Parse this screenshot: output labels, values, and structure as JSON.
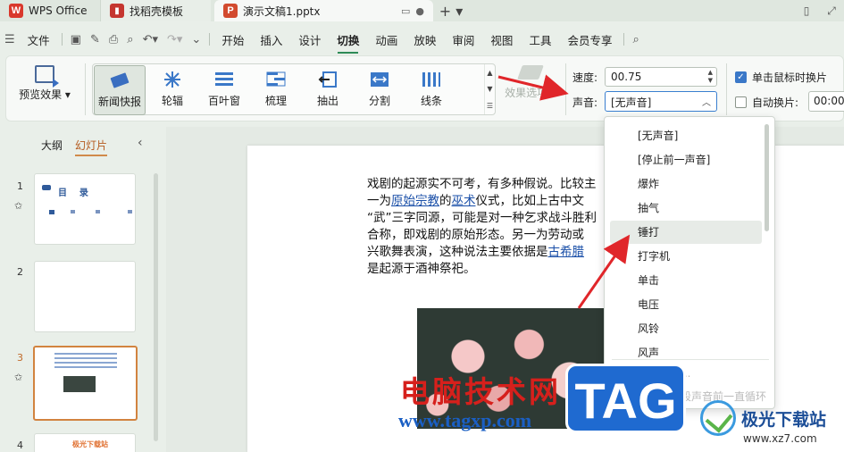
{
  "titlebar": {
    "app_tab": "WPS Office",
    "template_tab": "找稻壳模板",
    "doc_tab": "演示文稿1.pptx"
  },
  "menu": {
    "file": "文件",
    "items": [
      "开始",
      "插入",
      "设计",
      "切换",
      "动画",
      "放映",
      "审阅",
      "视图",
      "工具",
      "会员专享"
    ],
    "active": "切换"
  },
  "ribbon": {
    "preview_label": "预览效果",
    "transitions": [
      "新闻快报",
      "轮辐",
      "百叶窗",
      "梳理",
      "抽出",
      "分割",
      "线条"
    ],
    "selected_transition": "新闻快报",
    "effect_options": "效果选项",
    "speed_label": "速度:",
    "speed_value": "00.75",
    "sound_label": "声音:",
    "sound_value": "[无声音]",
    "click_advance_label": "单击鼠标时换片",
    "auto_advance_label": "自动换片:",
    "auto_time": "00:00"
  },
  "left_panel": {
    "tab_outline": "大纲",
    "tab_slides": "幻灯片",
    "slide_numbers": [
      "1",
      "2",
      "3",
      "4"
    ],
    "thumb1_title": "目    录",
    "thumb4_title": "极光下载站"
  },
  "slide": {
    "lines": [
      "戏剧的起源实不可考，有多种假说。比较主",
      "一为原始宗教的巫术仪式，比如上古中文",
      "“武”三字同源，可能是对一种乞求战斗胜利",
      "合称，即戏剧的原始形态。另一为劳动或",
      "兴歌舞表演，这种说法主要依据是古希腊",
      "是起源于酒神祭祀。"
    ],
    "link_primitive_religion": "原始宗教",
    "link_witchcraft": "巫术",
    "link_greece": "古希腊"
  },
  "sound_dropdown": {
    "items": [
      "[无声音]",
      "[停止前一声音]",
      "爆炸",
      "抽气",
      "锤打",
      "打字机",
      "单击",
      "电压",
      "风铃",
      "风声"
    ],
    "highlighted": "锤打",
    "footer_other": "来自文件...",
    "footer_loop": "播放下一段声音前一直循环"
  },
  "watermark": {
    "title": "电脑技术网",
    "url": "www.tagxp.com",
    "tag": "TAG",
    "site_name": "极光下载站",
    "site_url": "www.xz7.com"
  },
  "colors": {
    "accent_green": "#2e8b57",
    "selected_orange": "#d2833f",
    "annotation_red": "#e0262a",
    "link_blue": "#1a4fa8"
  }
}
